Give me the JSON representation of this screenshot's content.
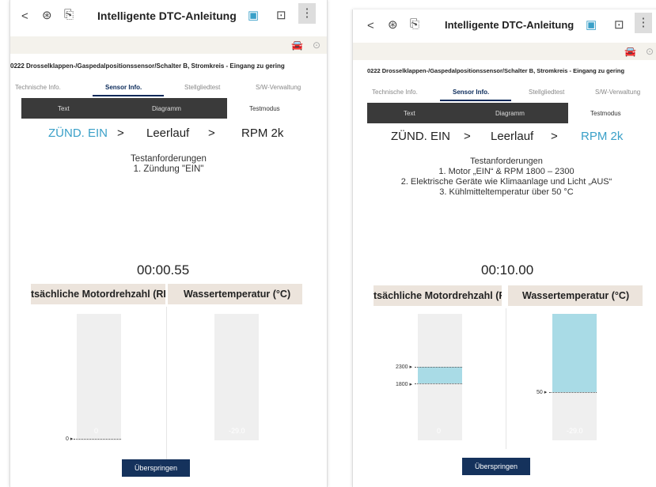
{
  "panels": [
    {
      "header": {
        "back": "<",
        "title": "Intelligente DTC-Anleitung"
      },
      "dtc_text": "0222 Drosselklappen-/Gaspedalpositionssensor/Schalter B, Stromkreis - Eingang zu gering",
      "tabs": [
        "Technische Info.",
        "Sensor Info.",
        "Stellgliedtest",
        "S/W-Verwaltung"
      ],
      "sub_tabs": [
        "Text",
        "Diagramm",
        "Testmodus"
      ],
      "steps": [
        "ZÜND. EIN",
        ">",
        "Leerlauf",
        ">",
        "RPM 2k"
      ],
      "requirements": [
        "Testanforderungen",
        "1. Zündung \"EIN\""
      ],
      "timer": "00:00.55",
      "gauges": [
        {
          "label": "tsächliche Motordrehzahl (RP",
          "marker": "0 ▸",
          "value": "0"
        },
        {
          "label": "Wassertemperatur (°C)",
          "value": "-29.0"
        }
      ],
      "skip_label": "Überspringen"
    },
    {
      "header": {
        "back": "<",
        "title": "Intelligente DTC-Anleitung"
      },
      "dtc_text": "0222 Drosselklappen-/Gaspedalpositionssensor/Schalter B, Stromkreis - Eingang zu gering",
      "tabs": [
        "Technische Info.",
        "Sensor Info.",
        "Stellgliedtest",
        "S/W-Verwaltung"
      ],
      "sub_tabs": [
        "Text",
        "Diagramm",
        "Testmodus"
      ],
      "steps": [
        "ZÜND. EIN",
        ">",
        "Leerlauf",
        ">",
        "RPM 2k"
      ],
      "requirements": [
        "Testanforderungen",
        "1. Motor „EIN“ & RPM 1800 – 2300",
        "2. Elektrische Geräte wie Klimaanlage und Licht „AUS“",
        "3. Kühlmitteltemperatur über 50 °C"
      ],
      "timer": "00:10.00",
      "gauges": [
        {
          "label": "tsächliche Motordrehzahl (RP",
          "marker_high": "2300 ▸",
          "marker_low": "1800 ▸",
          "value": "0"
        },
        {
          "label": "Wassertemperatur (°C)",
          "marker": "50 ▸",
          "value": "-29.0"
        }
      ],
      "skip_label": "Überspringen"
    }
  ],
  "colors": {
    "active_step": "#3aa0c8",
    "fill": "#a9dbe6",
    "button": "#15325c"
  },
  "icons": [
    "back-icon",
    "vehicle-icon",
    "export-icon",
    "screen-share-icon",
    "capture-icon",
    "more-icon",
    "car-icon",
    "settings-icon"
  ]
}
